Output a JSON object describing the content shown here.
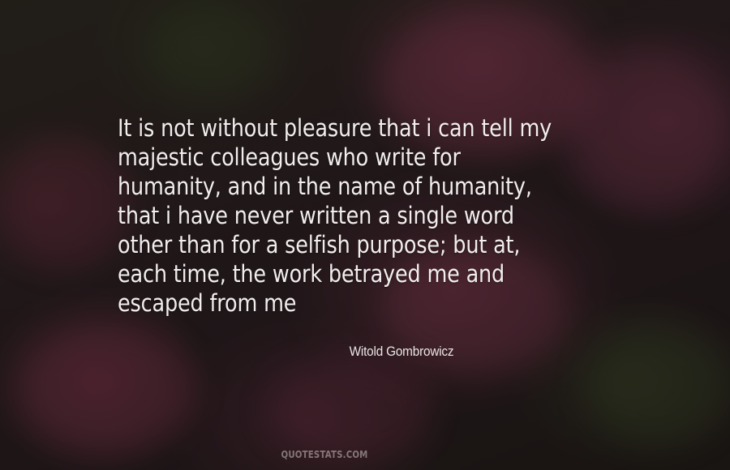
{
  "quote": {
    "lines": [
      "It is not without pleasure that i can tell my",
      "majestic colleagues who write for",
      "humanity, and in the name of humanity,",
      "that i have never written a single word",
      "other than for a selfish purpose; but at,",
      "each time, the work betrayed me and",
      "escaped from me"
    ]
  },
  "author": "Witold Gombrowicz",
  "watermark": "QUOTESTATS.COM",
  "colors": {
    "text": "#f2eeee",
    "flower_pink": "#a3466a",
    "background_dark": "#1f1a16"
  }
}
